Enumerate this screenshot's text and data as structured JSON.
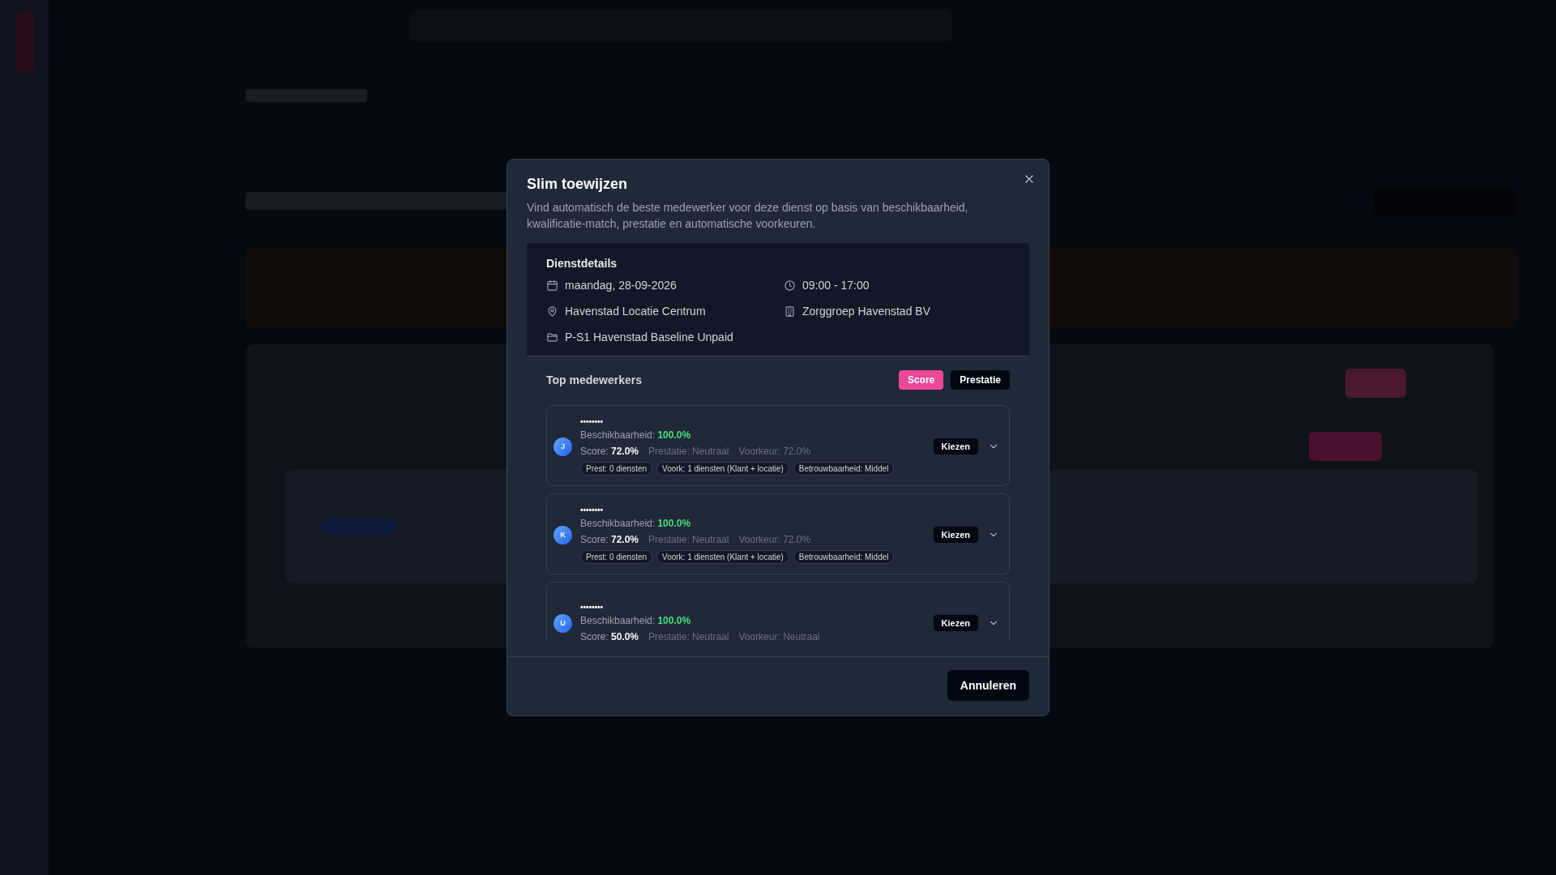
{
  "dialog": {
    "title": "Slim toewijzen",
    "description": "Vind automatisch de beste medewerker voor deze dienst op basis van beschikbaarheid, kwalificatie-match, prestatie en automatische voorkeuren.",
    "details": {
      "heading": "Dienstdetails",
      "items": [
        {
          "kind": "date",
          "text": "maandag, 28-09-2026"
        },
        {
          "kind": "time",
          "text": "09:00 - 17:00"
        },
        {
          "kind": "location",
          "text": "Havenstad Locatie Centrum"
        },
        {
          "kind": "organization",
          "text": "Zorggroep Havenstad BV"
        },
        {
          "kind": "project",
          "text": "P-S1 Havenstad Baseline Unpaid"
        }
      ]
    },
    "candidates_heading": "Top medewerkers",
    "sort_buttons": [
      {
        "label": "Score",
        "selected": true
      },
      {
        "label": "Prestatie",
        "selected": false
      }
    ],
    "candidates": [
      {
        "initial": "J",
        "name": "••••••••",
        "availability_label": "Beschikbaarheid:",
        "availability": "100.0%",
        "score_label": "Score:",
        "score": "72.0%",
        "performance": "Prestatie: Neutraal",
        "preference": "Voorkeur: 72.0%",
        "tags": [
          "Prest: 0 diensten",
          "Voork: 1 diensten (Klant + locatie)",
          "Betrouwbaarheid: Middel"
        ],
        "choose": "Kiezen",
        "expanded": false
      },
      {
        "initial": "K",
        "name": "••••••••",
        "availability_label": "Beschikbaarheid:",
        "availability": "100.0%",
        "score_label": "Score:",
        "score": "72.0%",
        "performance": "Prestatie: Neutraal",
        "preference": "Voorkeur: 72.0%",
        "tags": [
          "Prest: 0 diensten",
          "Voork: 1 diensten (Klant + locatie)",
          "Betrouwbaarheid: Middel"
        ],
        "choose": "Kiezen",
        "expanded": false
      },
      {
        "initial": "U",
        "name": "••••••••",
        "availability_label": "Beschikbaarheid:",
        "availability": "100.0%",
        "score_label": "Score:",
        "score": "50.0%",
        "performance": "Prestatie: Neutraal",
        "preference": "Voorkeur: Neutraal",
        "choose": "Kiezen",
        "expanded": false
      }
    ],
    "cancel": "Annuleren"
  }
}
